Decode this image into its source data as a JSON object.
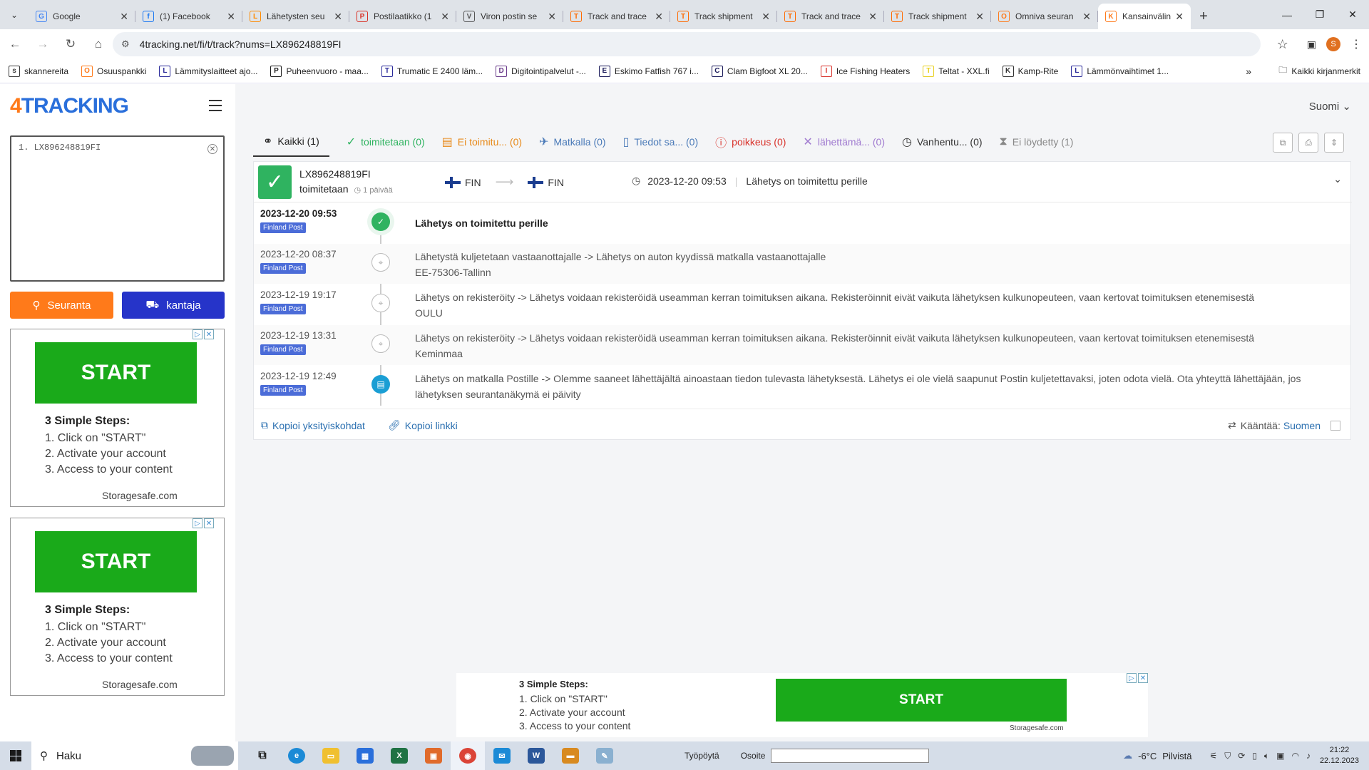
{
  "browser": {
    "tabs": [
      {
        "title": "Google",
        "icon": "google-icon",
        "color": "#4285f4"
      },
      {
        "title": "(1) Facebook",
        "icon": "facebook-icon",
        "color": "#1877f2"
      },
      {
        "title": "Lähetysten seu",
        "icon": "posti-icon",
        "color": "#ff8a00"
      },
      {
        "title": "Postilaatikko (1",
        "icon": "gmail-icon",
        "color": "#d93025"
      },
      {
        "title": "Viron postin se",
        "icon": "globe-icon",
        "color": "#555555"
      },
      {
        "title": "Track and trace",
        "icon": "track-icon",
        "color": "#ff6a00"
      },
      {
        "title": "Track shipment",
        "icon": "track-icon",
        "color": "#ff6a00"
      },
      {
        "title": "Track and trace",
        "icon": "track-icon",
        "color": "#ff6a00"
      },
      {
        "title": "Track shipment",
        "icon": "track-icon",
        "color": "#ff6a00"
      },
      {
        "title": "Omniva seuran",
        "icon": "4tracking-icon",
        "color": "#ff7a1a"
      },
      {
        "title": "Kansainvälinen",
        "icon": "4tracking-icon",
        "color": "#ff7a1a",
        "active": true
      }
    ],
    "url": "4tracking.net/fi/t/track?nums=LX896248819FI",
    "profile_initial": "S"
  },
  "bookmarks": {
    "items": [
      {
        "label": "skannereita",
        "icon": "folder-icon"
      },
      {
        "label": "Osuuspankki",
        "icon": "op-icon"
      },
      {
        "label": "Lämmityslaitteet ajo...",
        "icon": "bookmark-icon"
      },
      {
        "label": "Puheenvuoro - maa...",
        "icon": "us-icon"
      },
      {
        "label": "Trumatic E 2400 läm...",
        "icon": "bookmark-icon"
      },
      {
        "label": "Digitointipalvelut -...",
        "icon": "bookmark-icon"
      },
      {
        "label": "Eskimo Fatfish 767 i...",
        "icon": "bookmark-icon"
      },
      {
        "label": "Clam Bigfoot XL 20...",
        "icon": "bookmark-icon"
      },
      {
        "label": "Ice Fishing Heaters",
        "icon": "r-icon"
      },
      {
        "label": "Teltat - XXL.fi",
        "icon": "xxl-icon"
      },
      {
        "label": "Kamp-Rite",
        "icon": "kamprite-icon"
      },
      {
        "label": "Lämmönvaihtimet 1...",
        "icon": "bookmark-icon"
      }
    ],
    "all_bookmarks": "Kaikki kirjanmerkit"
  },
  "site": {
    "logo_4": "4",
    "logo_rest": "TRACKING",
    "language": "Suomi",
    "numbers_text": "1. LX896248819FI",
    "track_button": "Seuranta",
    "carrier_button": "kantaja",
    "filters": [
      {
        "label": "Kaikki (1)",
        "color": "#222222",
        "icon": "all-icon",
        "active": true
      },
      {
        "label": "toimitetaan (0)",
        "color": "#2fb360",
        "icon": "check-icon"
      },
      {
        "label": "Ei toimitu...  (0)",
        "color": "#e88a1a",
        "icon": "box-icon"
      },
      {
        "label": "Matkalla (0)",
        "color": "#4a7ab8",
        "icon": "plane-icon"
      },
      {
        "label": "Tiedot sa...  (0)",
        "color": "#4a7ab8",
        "icon": "document-icon"
      },
      {
        "label": "poikkeus (0)",
        "color": "#d9322b",
        "icon": "alert-icon"
      },
      {
        "label": "lähettämä...  (0)",
        "color": "#a07ad0",
        "icon": "x-icon"
      },
      {
        "label": "Vanhentu...  (0)",
        "color": "#333333",
        "icon": "history-icon"
      },
      {
        "label": "Ei löydetty (1)",
        "color": "#888888",
        "icon": "hourglass-icon"
      }
    ],
    "shipment": {
      "number": "LX896248819FI",
      "status": "toimitetaan",
      "days": "1 päivää",
      "from": "FIN",
      "to": "FIN",
      "time": "2023-12-20 09:53",
      "latest": "Lähetys on toimitettu perille"
    },
    "events": [
      {
        "date": "2023-12-20 09:53",
        "carrier": "Finland Post",
        "line1": "Lähetys on toimitettu perille",
        "line2": "",
        "node": "ok"
      },
      {
        "date": "2023-12-20 08:37",
        "carrier": "Finland Post",
        "line1": "Lähetystä kuljetetaan vastaanottajalle -> Lähetys on auton kyydissä matkalla vastaanottajalle",
        "line2": "EE-75306-Tallinn",
        "node": "pin"
      },
      {
        "date": "2023-12-19 19:17",
        "carrier": "Finland Post",
        "line1": "Lähetys on rekisteröity -> Lähetys voidaan rekisteröidä useamman kerran toimituksen aikana. Rekisteröinnit eivät vaikuta lähetyksen kulkunopeuteen, vaan kertovat toimituksen etenemisestä",
        "line2": "OULU",
        "node": "pin"
      },
      {
        "date": "2023-12-19 13:31",
        "carrier": "Finland Post",
        "line1": "Lähetys on rekisteröity -> Lähetys voidaan rekisteröidä useamman kerran toimituksen aikana. Rekisteröinnit eivät vaikuta lähetyksen kulkunopeuteen, vaan kertovat toimituksen etenemisestä",
        "line2": "Keminmaa",
        "node": "pin"
      },
      {
        "date": "2023-12-19 12:49",
        "carrier": "Finland Post",
        "line1": "Lähetys on matkalla Postille -> Olemme saaneet lähettäjältä ainoastaan tiedon tulevasta lähetyksestä. Lähetys ei ole vielä saapunut Postin kuljetettavaksi, joten odota vielä. Ota yhteyttä lähettäjään, jos lähetyksen seurantanäkymä ei päivity",
        "line2": "",
        "node": "doc"
      }
    ],
    "copy_details": "Kopioi yksityiskohdat",
    "copy_link": "Kopioi linkki",
    "translate_label": "Kääntää:",
    "translate_lang": "Suomen"
  },
  "ads": {
    "start": "START",
    "heading": "3 Simple Steps:",
    "steps": [
      "1. Click on \"START\"",
      "2. Activate your account",
      "3. Access to your content"
    ],
    "source": "Storagesafe.com"
  },
  "taskbar": {
    "search": "Haku",
    "desktop": "Työpöytä",
    "address_label": "Osoite",
    "temperature": "-6°C",
    "weather": "Pilvistä",
    "time": "21:22",
    "date": "22.12.2023"
  }
}
